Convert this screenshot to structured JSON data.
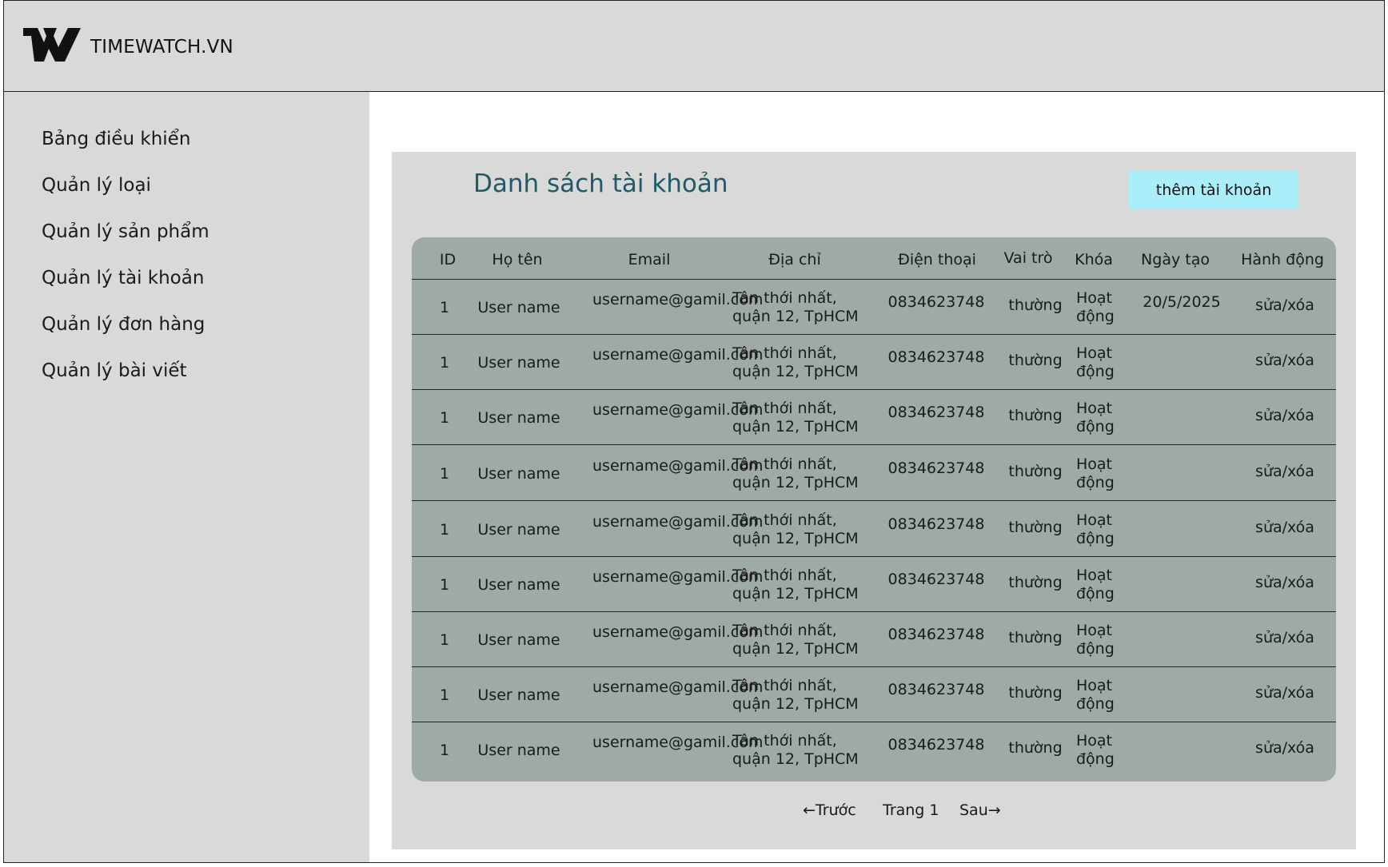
{
  "header": {
    "brand": "TIMEWATCH.VN"
  },
  "sidebar": {
    "items": [
      {
        "label": "Bảng điều khiển"
      },
      {
        "label": "Quản lý loại"
      },
      {
        "label": "Quản lý sản phẩm"
      },
      {
        "label": "Quản lý tài khoản"
      },
      {
        "label": "Quản lý đơn hàng"
      },
      {
        "label": "Quản lý bài viết"
      }
    ]
  },
  "main": {
    "title": "Danh sách tài khoản",
    "add_button": "thêm tài khoản",
    "columns": [
      "ID",
      "Họ tên",
      "Email",
      "Địa chỉ",
      "Điện thoại",
      "Vai trò",
      "Khóa",
      "Ngày tạo",
      "Hành động"
    ],
    "rows": [
      {
        "id": "1",
        "name": "User name",
        "email": "username@gamil.com",
        "address": "Tân thới nhất, quận 12, TpHCM",
        "phone": "0834623748",
        "role": "thường",
        "lock": "Hoạt động",
        "created": "20/5/2025",
        "action": "sửa/xóa"
      },
      {
        "id": "1",
        "name": "User name",
        "email": "username@gamil.com",
        "address": "Tân thới nhất, quận 12, TpHCM",
        "phone": "0834623748",
        "role": "thường",
        "lock": "Hoạt động",
        "created": "",
        "action": "sửa/xóa"
      },
      {
        "id": "1",
        "name": "User name",
        "email": "username@gamil.com",
        "address": "Tân thới nhất, quận 12, TpHCM",
        "phone": "0834623748",
        "role": "thường",
        "lock": "Hoạt động",
        "created": "",
        "action": "sửa/xóa"
      },
      {
        "id": "1",
        "name": "User name",
        "email": "username@gamil.com",
        "address": "Tân thới nhất, quận 12, TpHCM",
        "phone": "0834623748",
        "role": "thường",
        "lock": "Hoạt động",
        "created": "",
        "action": "sửa/xóa"
      },
      {
        "id": "1",
        "name": "User name",
        "email": "username@gamil.com",
        "address": "Tân thới nhất, quận 12, TpHCM",
        "phone": "0834623748",
        "role": "thường",
        "lock": "Hoạt động",
        "created": "",
        "action": "sửa/xóa"
      },
      {
        "id": "1",
        "name": "User name",
        "email": "username@gamil.com",
        "address": "Tân thới nhất, quận 12, TpHCM",
        "phone": "0834623748",
        "role": "thường",
        "lock": "Hoạt động",
        "created": "",
        "action": "sửa/xóa"
      },
      {
        "id": "1",
        "name": "User name",
        "email": "username@gamil.com",
        "address": "Tân thới nhất, quận 12, TpHCM",
        "phone": "0834623748",
        "role": "thường",
        "lock": "Hoạt động",
        "created": "",
        "action": "sửa/xóa"
      },
      {
        "id": "1",
        "name": "User name",
        "email": "username@gamil.com",
        "address": "Tân thới nhất, quận 12, TpHCM",
        "phone": "0834623748",
        "role": "thường",
        "lock": "Hoạt động",
        "created": "",
        "action": "sửa/xóa"
      },
      {
        "id": "1",
        "name": "User name",
        "email": "username@gamil.com",
        "address": "Tân thới nhất, quận 12, TpHCM",
        "phone": "0834623748",
        "role": "thường",
        "lock": "Hoạt động",
        "created": "",
        "action": "sửa/xóa"
      }
    ]
  },
  "pagination": {
    "prev": "←Trước",
    "current": "Trang 1",
    "next": "Sau→"
  }
}
